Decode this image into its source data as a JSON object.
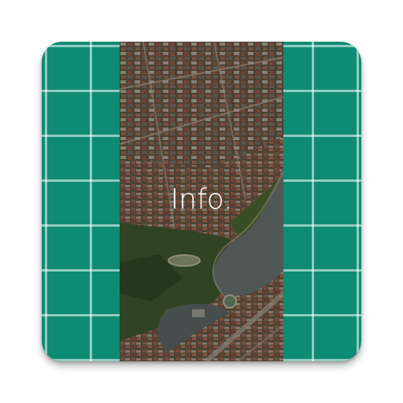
{
  "icon": {
    "label": "Info.",
    "colors": {
      "panel": "#0e8b73",
      "grid_line": "#8fd1c2",
      "label_text": "#ffffff"
    }
  }
}
